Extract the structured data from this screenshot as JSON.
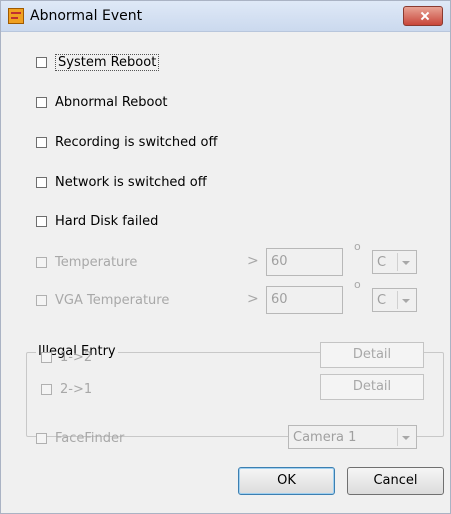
{
  "window": {
    "title": "Abnormal Event"
  },
  "events": [
    {
      "label": "System Reboot",
      "checked": false,
      "enabled": true
    },
    {
      "label": "Abnormal Reboot",
      "checked": false,
      "enabled": true
    },
    {
      "label": "Recording is switched off",
      "checked": false,
      "enabled": true
    },
    {
      "label": "Network is switched off",
      "checked": false,
      "enabled": true
    },
    {
      "label": "Hard Disk failed",
      "checked": false,
      "enabled": true
    }
  ],
  "temperature": {
    "label": "Temperature",
    "operator": ">",
    "value": "60",
    "degree_symbol": "o",
    "unit": "C"
  },
  "vga_temperature": {
    "label": "VGA Temperature",
    "operator": ">",
    "value": "60",
    "degree_symbol": "o",
    "unit": "C"
  },
  "illegal_entry": {
    "title": "Illegal Entry",
    "items": [
      {
        "label": "1->2",
        "button": "Detail"
      },
      {
        "label": "2->1",
        "button": "Detail"
      }
    ]
  },
  "facefinder": {
    "label": "FaceFinder",
    "camera": "Camera 1"
  },
  "buttons": {
    "ok": "OK",
    "cancel": "Cancel"
  }
}
